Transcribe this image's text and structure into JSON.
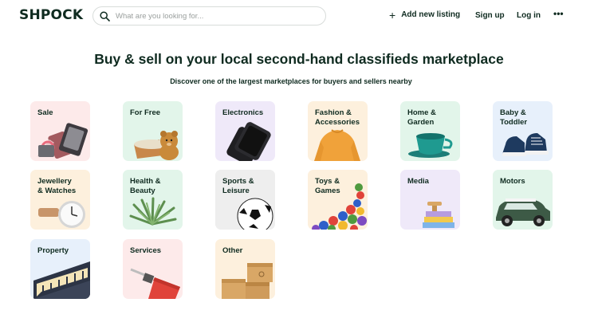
{
  "header": {
    "logo": "SHPOCK",
    "search_placeholder": "What are you looking for...",
    "add_listing": "Add new listing",
    "add_icon": "+",
    "signup": "Sign up",
    "login": "Log in",
    "more_icon": "•••"
  },
  "hero": {
    "title": "Buy & sell on your local second-hand classifieds marketplace",
    "subtitle": "Discover one of the largest marketplaces for buyers and sellers nearby"
  },
  "categories": [
    {
      "label": "Sale",
      "bg": "#fdeaea"
    },
    {
      "label": "For Free",
      "bg": "#e2f5ea"
    },
    {
      "label": "Electronics",
      "bg": "#efe9f9"
    },
    {
      "label": "Fashion &\nAccessories",
      "bg": "#fdf0dd"
    },
    {
      "label": "Home &\nGarden",
      "bg": "#e2f5ea"
    },
    {
      "label": "Baby &\nToddler",
      "bg": "#e7f0fb"
    },
    {
      "label": "Jewellery\n& Watches",
      "bg": "#fdf0dd"
    },
    {
      "label": "Health &\nBeauty",
      "bg": "#e2f5ea"
    },
    {
      "label": "Sports &\nLeisure",
      "bg": "#eeeeee"
    },
    {
      "label": "Toys &\nGames",
      "bg": "#fdf0dd"
    },
    {
      "label": "Media",
      "bg": "#efe9f9"
    },
    {
      "label": "Motors",
      "bg": "#e2f5ea"
    },
    {
      "label": "Property",
      "bg": "#e7f0fb"
    },
    {
      "label": "Services",
      "bg": "#fdeaea"
    },
    {
      "label": "Other",
      "bg": "#fdf0dd"
    }
  ]
}
